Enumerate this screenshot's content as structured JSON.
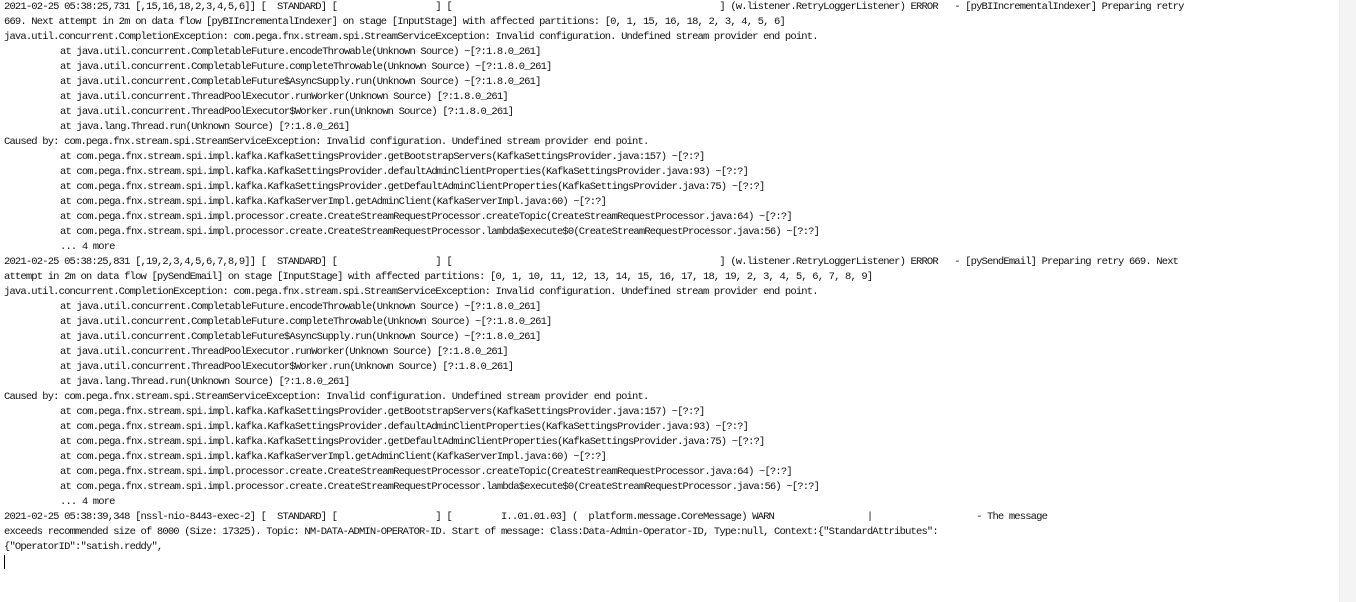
{
  "log": {
    "lines": [
      "2021-02-25 05:38:25,731 [,15,16,18,2,3,4,5,6]] [  STANDARD] [                  ] [                                                 ] (w.listener.RetryLoggerListener) ERROR   - [pyBIIncrementalIndexer] Preparing retry",
      "669. Next attempt in 2m on data flow [pyBIIncrementalIndexer] on stage [InputStage] with affected partitions: [0, 1, 15, 16, 18, 2, 3, 4, 5, 6]",
      "java.util.concurrent.CompletionException: com.pega.fnx.stream.spi.StreamServiceException: Invalid configuration. Undefined stream provider end point.",
      "\tat java.util.concurrent.CompletableFuture.encodeThrowable(Unknown Source) ~[?:1.8.0_261]",
      "\tat java.util.concurrent.CompletableFuture.completeThrowable(Unknown Source) ~[?:1.8.0_261]",
      "\tat java.util.concurrent.CompletableFuture$AsyncSupply.run(Unknown Source) ~[?:1.8.0_261]",
      "\tat java.util.concurrent.ThreadPoolExecutor.runWorker(Unknown Source) [?:1.8.0_261]",
      "\tat java.util.concurrent.ThreadPoolExecutor$Worker.run(Unknown Source) [?:1.8.0_261]",
      "\tat java.lang.Thread.run(Unknown Source) [?:1.8.0_261]",
      "Caused by: com.pega.fnx.stream.spi.StreamServiceException: Invalid configuration. Undefined stream provider end point.",
      "\tat com.pega.fnx.stream.spi.impl.kafka.KafkaSettingsProvider.getBootstrapServers(KafkaSettingsProvider.java:157) ~[?:?]",
      "\tat com.pega.fnx.stream.spi.impl.kafka.KafkaSettingsProvider.defaultAdminClientProperties(KafkaSettingsProvider.java:93) ~[?:?]",
      "\tat com.pega.fnx.stream.spi.impl.kafka.KafkaSettingsProvider.getDefaultAdminClientProperties(KafkaSettingsProvider.java:75) ~[?:?]",
      "\tat com.pega.fnx.stream.spi.impl.kafka.KafkaServerImpl.getAdminClient(KafkaServerImpl.java:60) ~[?:?]",
      "\tat com.pega.fnx.stream.spi.impl.processor.create.CreateStreamRequestProcessor.createTopic(CreateStreamRequestProcessor.java:64) ~[?:?]",
      "\tat com.pega.fnx.stream.spi.impl.processor.create.CreateStreamRequestProcessor.lambda$execute$0(CreateStreamRequestProcessor.java:56) ~[?:?]",
      "\t... 4 more",
      "2021-02-25 05:38:25,831 [,19,2,3,4,5,6,7,8,9]] [  STANDARD] [                  ] [                                                 ] (w.listener.RetryLoggerListener) ERROR   - [pySendEmail] Preparing retry 669. Next",
      "attempt in 2m on data flow [pySendEmail] on stage [InputStage] with affected partitions: [0, 1, 10, 11, 12, 13, 14, 15, 16, 17, 18, 19, 2, 3, 4, 5, 6, 7, 8, 9]",
      "java.util.concurrent.CompletionException: com.pega.fnx.stream.spi.StreamServiceException: Invalid configuration. Undefined stream provider end point.",
      "\tat java.util.concurrent.CompletableFuture.encodeThrowable(Unknown Source) ~[?:1.8.0_261]",
      "\tat java.util.concurrent.CompletableFuture.completeThrowable(Unknown Source) ~[?:1.8.0_261]",
      "\tat java.util.concurrent.CompletableFuture$AsyncSupply.run(Unknown Source) ~[?:1.8.0_261]",
      "\tat java.util.concurrent.ThreadPoolExecutor.runWorker(Unknown Source) [?:1.8.0_261]",
      "\tat java.util.concurrent.ThreadPoolExecutor$Worker.run(Unknown Source) [?:1.8.0_261]",
      "\tat java.lang.Thread.run(Unknown Source) [?:1.8.0_261]",
      "Caused by: com.pega.fnx.stream.spi.StreamServiceException: Invalid configuration. Undefined stream provider end point.",
      "\tat com.pega.fnx.stream.spi.impl.kafka.KafkaSettingsProvider.getBootstrapServers(KafkaSettingsProvider.java:157) ~[?:?]",
      "\tat com.pega.fnx.stream.spi.impl.kafka.KafkaSettingsProvider.defaultAdminClientProperties(KafkaSettingsProvider.java:93) ~[?:?]",
      "\tat com.pega.fnx.stream.spi.impl.kafka.KafkaSettingsProvider.getDefaultAdminClientProperties(KafkaSettingsProvider.java:75) ~[?:?]",
      "\tat com.pega.fnx.stream.spi.impl.kafka.KafkaServerImpl.getAdminClient(KafkaServerImpl.java:60) ~[?:?]",
      "\tat com.pega.fnx.stream.spi.impl.processor.create.CreateStreamRequestProcessor.createTopic(CreateStreamRequestProcessor.java:64) ~[?:?]",
      "\tat com.pega.fnx.stream.spi.impl.processor.create.CreateStreamRequestProcessor.lambda$execute$0(CreateStreamRequestProcessor.java:56) ~[?:?]",
      "\t... 4 more",
      "2021-02-25 05:38:39,348 [nssl-nio-8443-exec-2] [  STANDARD] [                  ] [         I..01.01.03] (  platform.message.CoreMessage) WARN                 |                   - The message",
      "exceeds recommended size of 8000 (Size: 17325). Topic: NM-DATA-ADMIN-OPERATOR-ID. Start of message: Class:Data-Admin-Operator-ID, Type:null, Context:{\"StandardAttributes\":",
      "{\"OperatorID\":\"satish.reddy\","
    ]
  }
}
